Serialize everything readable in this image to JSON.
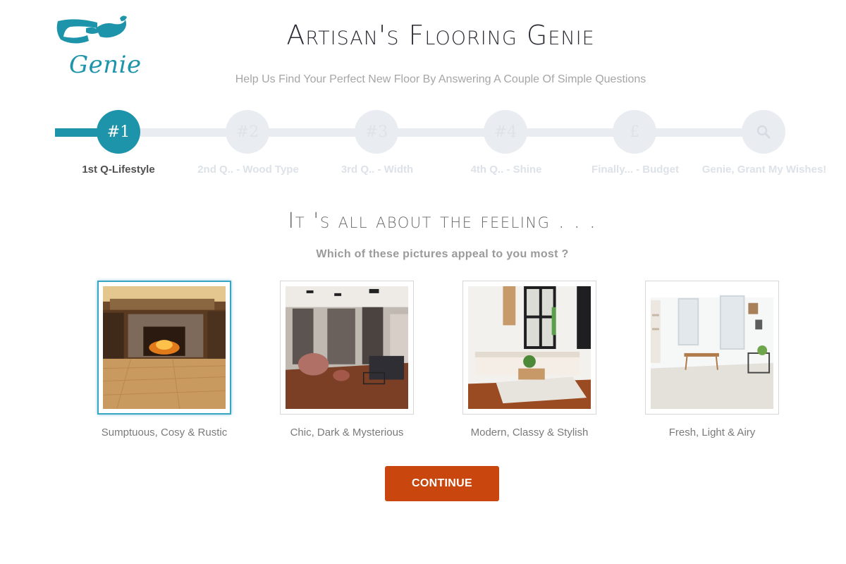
{
  "header": {
    "logo_text": "Genie",
    "title": "Artisan's Flooring Genie",
    "subtitle": "Help Us Find Your Perfect New Floor By Answering A Couple Of Simple Questions"
  },
  "stepper": {
    "steps": [
      {
        "marker": "#1",
        "label": "1st Q-Lifestyle",
        "active": true
      },
      {
        "marker": "#2",
        "label": "2nd Q.. - Wood Type",
        "active": false
      },
      {
        "marker": "#3",
        "label": "3rd Q.. - Width",
        "active": false
      },
      {
        "marker": "#4",
        "label": "4th Q.. - Shine",
        "active": false
      },
      {
        "marker": "£",
        "label": "Finally... - Budget",
        "active": false
      },
      {
        "marker": "search-icon",
        "label": "Genie, Grant My Wishes!",
        "active": false
      }
    ]
  },
  "question": {
    "heading": "It 's all about the feeling . . .",
    "prompt": "Which of these pictures appeal to you most ?"
  },
  "options": [
    {
      "caption": "Sumptuous, Cosy & Rustic",
      "selected": true
    },
    {
      "caption": "Chic, Dark & Mysterious",
      "selected": false
    },
    {
      "caption": "Modern, Classy & Stylish",
      "selected": false
    },
    {
      "caption": "Fresh, Light & Airy",
      "selected": false
    }
  ],
  "actions": {
    "continue_label": "CONTINUE"
  },
  "colors": {
    "accent": "#1d94aa",
    "button": "#c9460f",
    "inactive_step": "#e9edf2"
  }
}
